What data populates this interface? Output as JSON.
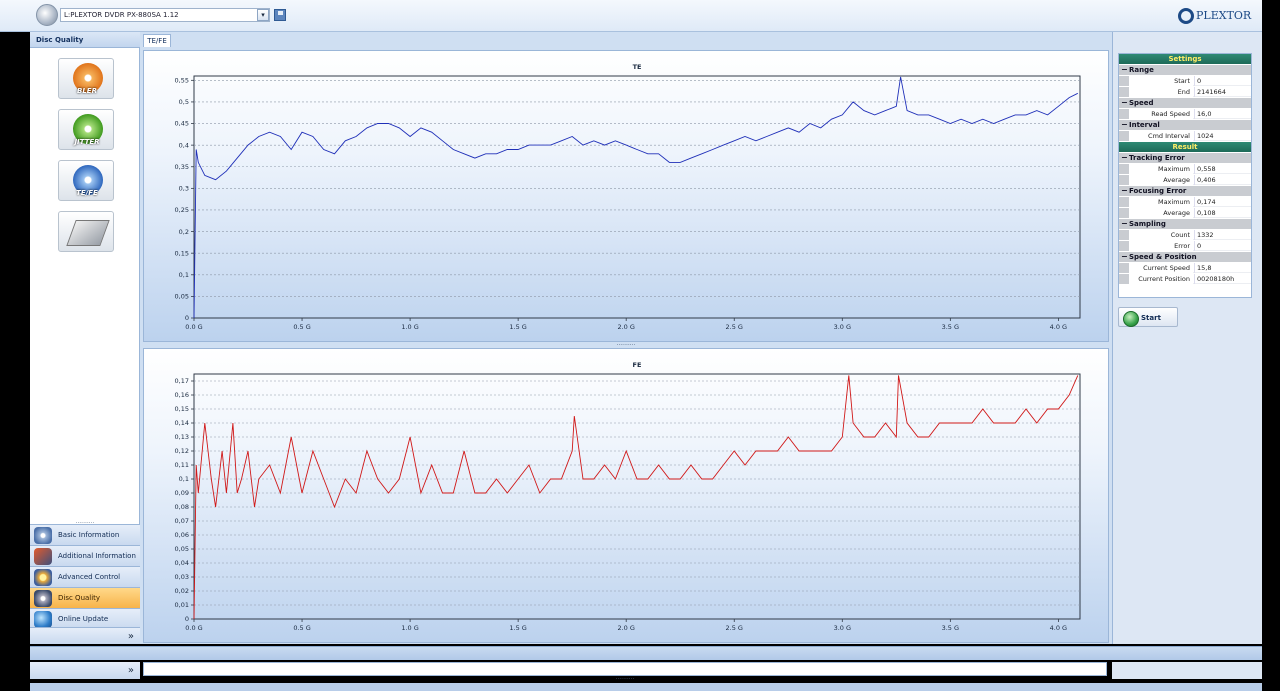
{
  "header": {
    "drive": "L:PLEXTOR DVDR  PX-880SA  1.12",
    "dropdown_glyph": "▾",
    "logo": "PLEXTOR"
  },
  "sidebar": {
    "title": "Disc Quality",
    "tools": [
      {
        "label": "BLER",
        "icon": "bler-disc-icon",
        "color": "#f08a1c"
      },
      {
        "label": "JITTER",
        "icon": "jitter-disc-icon",
        "color": "#5cb82e"
      },
      {
        "label": "TE/FE",
        "icon": "tefe-disc-icon",
        "color": "#3f7fd0"
      },
      {
        "label": "",
        "icon": "drive-tool-icon"
      }
    ],
    "nav_grip": "..........",
    "nav": [
      {
        "label": "Basic Information",
        "icon": "cd-icon",
        "active": false
      },
      {
        "label": "Additional Information",
        "icon": "drive-icon",
        "active": false
      },
      {
        "label": "Advanced Control",
        "icon": "gear-icon",
        "active": false
      },
      {
        "label": "Disc Quality",
        "icon": "disc-quality-icon",
        "active": true
      },
      {
        "label": "Online Update",
        "icon": "globe-icon",
        "active": false
      }
    ],
    "chevron": "»"
  },
  "tabs": [
    {
      "label": "TE/FE",
      "active": true
    }
  ],
  "splitter_grip": "..........",
  "settings": {
    "settings_title": "Settings",
    "result_title": "Result",
    "range_button": "⊕",
    "groups": [
      {
        "name": "Range",
        "rows": [
          {
            "key": "Start",
            "value": "0"
          },
          {
            "key": "End",
            "value": "2141664"
          }
        ]
      },
      {
        "name": "Speed",
        "rows": [
          {
            "key": "Read Speed",
            "value": "16,0"
          }
        ]
      },
      {
        "name": "Interval",
        "rows": [
          {
            "key": "Cmd Interval",
            "value": "1024"
          }
        ]
      }
    ],
    "result_groups": [
      {
        "name": "Tracking Error",
        "rows": [
          {
            "key": "Maximum",
            "value": "0,558"
          },
          {
            "key": "Average",
            "value": "0,406"
          }
        ]
      },
      {
        "name": "Focusing Error",
        "rows": [
          {
            "key": "Maximum",
            "value": "0,174"
          },
          {
            "key": "Average",
            "value": "0,108"
          }
        ]
      },
      {
        "name": "Sampling",
        "rows": [
          {
            "key": "Count",
            "value": "1332"
          },
          {
            "key": "Error",
            "value": "0"
          }
        ]
      },
      {
        "name": "Speed & Position",
        "rows": [
          {
            "key": "Current Speed",
            "value": "15,8"
          },
          {
            "key": "Current Position",
            "value": "00208180h"
          }
        ]
      }
    ],
    "start_label": "Start"
  },
  "bottom": {
    "chevron": "»",
    "grip": ".........."
  },
  "chart_data": [
    {
      "type": "line",
      "title": "TE",
      "color": "#1f2fb8",
      "xlim": [
        0,
        4.1
      ],
      "ylim": [
        0,
        0.56
      ],
      "x_ticks": [
        0,
        0.5,
        1.0,
        1.5,
        2.0,
        2.5,
        3.0,
        3.5,
        4.0
      ],
      "x_tick_labels": [
        "0.0 G",
        "0.5 G",
        "1.0 G",
        "1.5 G",
        "2.0 G",
        "2.5 G",
        "3.0 G",
        "3.5 G",
        "4.0 G"
      ],
      "y_ticks": [
        0,
        0.05,
        0.1,
        0.15,
        0.2,
        0.25,
        0.3,
        0.35,
        0.4,
        0.45,
        0.5,
        0.55
      ],
      "y_tick_labels": [
        "0",
        "0,05",
        "0,1",
        "0,15",
        "0,2",
        "0,25",
        "0,3",
        "0,35",
        "0,4",
        "0,45",
        "0,5",
        "0,55"
      ],
      "grid": true,
      "x": [
        0,
        0.01,
        0.02,
        0.05,
        0.1,
        0.15,
        0.2,
        0.25,
        0.3,
        0.35,
        0.4,
        0.45,
        0.5,
        0.55,
        0.6,
        0.65,
        0.7,
        0.75,
        0.8,
        0.85,
        0.9,
        0.95,
        1.0,
        1.05,
        1.1,
        1.15,
        1.2,
        1.25,
        1.3,
        1.35,
        1.4,
        1.45,
        1.5,
        1.55,
        1.6,
        1.65,
        1.7,
        1.75,
        1.8,
        1.85,
        1.9,
        1.95,
        2.0,
        2.05,
        2.1,
        2.15,
        2.2,
        2.25,
        2.3,
        2.35,
        2.4,
        2.45,
        2.5,
        2.55,
        2.6,
        2.65,
        2.7,
        2.75,
        2.8,
        2.85,
        2.9,
        2.95,
        3.0,
        3.05,
        3.1,
        3.15,
        3.2,
        3.25,
        3.27,
        3.3,
        3.35,
        3.4,
        3.45,
        3.5,
        3.55,
        3.6,
        3.65,
        3.7,
        3.75,
        3.8,
        3.85,
        3.9,
        3.95,
        4.0,
        4.05,
        4.09
      ],
      "y": [
        0,
        0.39,
        0.36,
        0.33,
        0.32,
        0.34,
        0.37,
        0.4,
        0.42,
        0.43,
        0.42,
        0.39,
        0.43,
        0.42,
        0.39,
        0.38,
        0.41,
        0.42,
        0.44,
        0.45,
        0.45,
        0.44,
        0.42,
        0.44,
        0.43,
        0.41,
        0.39,
        0.38,
        0.37,
        0.38,
        0.38,
        0.39,
        0.39,
        0.4,
        0.4,
        0.4,
        0.41,
        0.42,
        0.4,
        0.41,
        0.4,
        0.41,
        0.4,
        0.39,
        0.38,
        0.38,
        0.36,
        0.36,
        0.37,
        0.38,
        0.39,
        0.4,
        0.41,
        0.42,
        0.41,
        0.42,
        0.43,
        0.44,
        0.43,
        0.45,
        0.44,
        0.46,
        0.47,
        0.5,
        0.48,
        0.47,
        0.48,
        0.49,
        0.558,
        0.48,
        0.47,
        0.47,
        0.46,
        0.45,
        0.46,
        0.45,
        0.46,
        0.45,
        0.46,
        0.47,
        0.47,
        0.48,
        0.47,
        0.49,
        0.51,
        0.52
      ]
    },
    {
      "type": "line",
      "title": "FE",
      "color": "#d01818",
      "xlim": [
        0,
        4.1
      ],
      "ylim": [
        0,
        0.175
      ],
      "x_ticks": [
        0,
        0.5,
        1.0,
        1.5,
        2.0,
        2.5,
        3.0,
        3.5,
        4.0
      ],
      "x_tick_labels": [
        "0.0 G",
        "0.5 G",
        "1.0 G",
        "1.5 G",
        "2.0 G",
        "2.5 G",
        "3.0 G",
        "3.5 G",
        "4.0 G"
      ],
      "y_ticks": [
        0,
        0.01,
        0.02,
        0.03,
        0.04,
        0.05,
        0.06,
        0.07,
        0.08,
        0.09,
        0.1,
        0.11,
        0.12,
        0.13,
        0.14,
        0.15,
        0.16,
        0.17
      ],
      "y_tick_labels": [
        "0",
        "0,01",
        "0,02",
        "0,03",
        "0,04",
        "0,05",
        "0,06",
        "0,07",
        "0,08",
        "0,09",
        "0,1",
        "0,11",
        "0,12",
        "0,13",
        "0,14",
        "0,15",
        "0,16",
        "0,17"
      ],
      "grid": true,
      "x": [
        0,
        0.01,
        0.02,
        0.05,
        0.08,
        0.1,
        0.13,
        0.15,
        0.18,
        0.2,
        0.22,
        0.25,
        0.28,
        0.3,
        0.35,
        0.4,
        0.45,
        0.5,
        0.55,
        0.6,
        0.65,
        0.7,
        0.75,
        0.8,
        0.85,
        0.9,
        0.95,
        1.0,
        1.05,
        1.1,
        1.15,
        1.2,
        1.25,
        1.3,
        1.35,
        1.4,
        1.45,
        1.5,
        1.55,
        1.6,
        1.65,
        1.7,
        1.75,
        1.76,
        1.8,
        1.85,
        1.9,
        1.95,
        2.0,
        2.05,
        2.1,
        2.15,
        2.2,
        2.25,
        2.3,
        2.35,
        2.4,
        2.45,
        2.5,
        2.55,
        2.6,
        2.65,
        2.7,
        2.75,
        2.8,
        2.85,
        2.9,
        2.95,
        3.0,
        3.03,
        3.05,
        3.1,
        3.15,
        3.2,
        3.25,
        3.26,
        3.3,
        3.35,
        3.4,
        3.45,
        3.5,
        3.55,
        3.6,
        3.65,
        3.7,
        3.75,
        3.8,
        3.85,
        3.9,
        3.95,
        4.0,
        4.05,
        4.09
      ],
      "y": [
        0,
        0.11,
        0.09,
        0.14,
        0.1,
        0.08,
        0.12,
        0.09,
        0.14,
        0.09,
        0.1,
        0.12,
        0.08,
        0.1,
        0.11,
        0.09,
        0.13,
        0.09,
        0.12,
        0.1,
        0.08,
        0.1,
        0.09,
        0.12,
        0.1,
        0.09,
        0.1,
        0.13,
        0.09,
        0.11,
        0.09,
        0.09,
        0.12,
        0.09,
        0.09,
        0.1,
        0.09,
        0.1,
        0.11,
        0.09,
        0.1,
        0.1,
        0.12,
        0.145,
        0.1,
        0.1,
        0.11,
        0.1,
        0.12,
        0.1,
        0.1,
        0.11,
        0.1,
        0.1,
        0.11,
        0.1,
        0.1,
        0.11,
        0.12,
        0.11,
        0.12,
        0.12,
        0.12,
        0.13,
        0.12,
        0.12,
        0.12,
        0.12,
        0.13,
        0.174,
        0.14,
        0.13,
        0.13,
        0.14,
        0.13,
        0.174,
        0.14,
        0.13,
        0.13,
        0.14,
        0.14,
        0.14,
        0.14,
        0.15,
        0.14,
        0.14,
        0.14,
        0.15,
        0.14,
        0.15,
        0.15,
        0.16,
        0.174
      ]
    }
  ]
}
